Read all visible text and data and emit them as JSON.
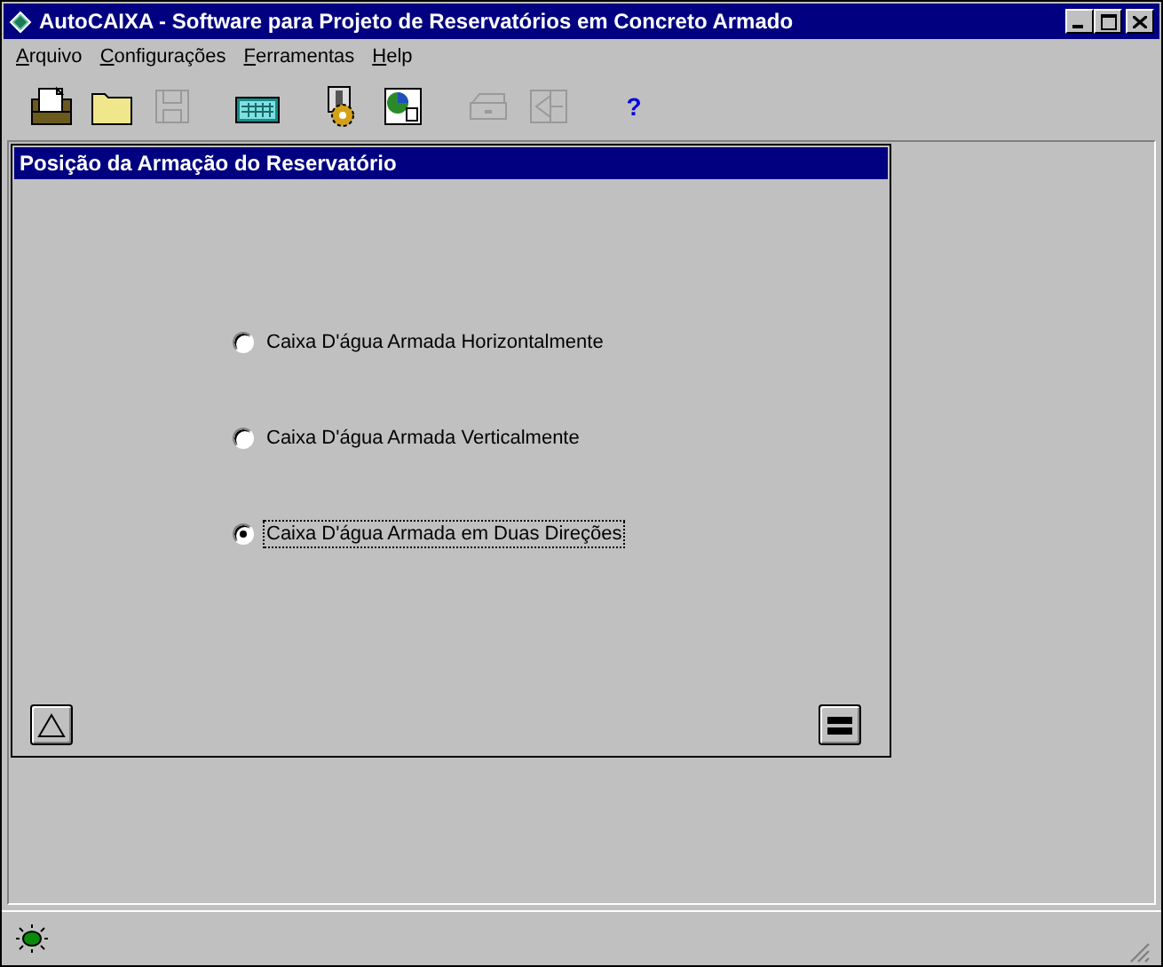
{
  "window": {
    "title": "AutoCAIXA - Software para Projeto de Reservatórios em Concreto Armado"
  },
  "menu": [
    {
      "label": "Arquivo"
    },
    {
      "label": "Configurações"
    },
    {
      "label": "Ferramentas"
    },
    {
      "label": "Help"
    }
  ],
  "toolbar": [
    {
      "kind": "new",
      "disabled": false
    },
    {
      "kind": "open",
      "disabled": false
    },
    {
      "kind": "save",
      "disabled": true
    },
    {
      "kind": "calculator",
      "disabled": false
    },
    {
      "kind": "gear",
      "disabled": false
    },
    {
      "kind": "chart",
      "disabled": false
    },
    {
      "kind": "print",
      "disabled": true
    },
    {
      "kind": "back",
      "disabled": true
    },
    {
      "kind": "help",
      "disabled": false,
      "text": "?"
    }
  ],
  "dialog": {
    "title": "Posição da Armação do Reservatório",
    "options": [
      {
        "label": "Caixa D'água Armada Horizontalmente",
        "selected": false,
        "focused": false
      },
      {
        "label": "Caixa D'água Armada Verticalmente",
        "selected": false,
        "focused": false
      },
      {
        "label": "Caixa D'água Armada em Duas Direções",
        "selected": true,
        "focused": true
      }
    ]
  }
}
